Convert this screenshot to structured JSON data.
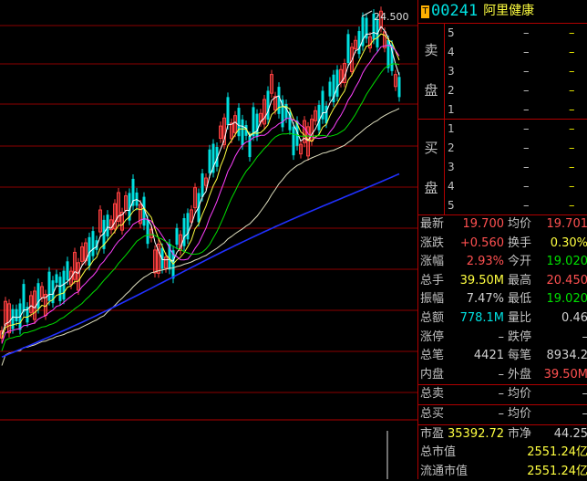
{
  "header": {
    "badge": "T",
    "code": "00241",
    "name": "阿里健康"
  },
  "chart": {
    "peak_label": "24.500",
    "grid_color": "#8b0000"
  },
  "order_book": {
    "sell_label_top": "卖",
    "sell_label_bottom": "盘",
    "buy_label_top": "买",
    "buy_label_bottom": "盘",
    "sell": [
      {
        "level": "5",
        "price": "–",
        "vol": "–"
      },
      {
        "level": "4",
        "price": "–",
        "vol": "–"
      },
      {
        "level": "3",
        "price": "–",
        "vol": "–"
      },
      {
        "level": "2",
        "price": "–",
        "vol": "–"
      },
      {
        "level": "1",
        "price": "–",
        "vol": "–"
      }
    ],
    "buy": [
      {
        "level": "1",
        "price": "–",
        "vol": "–"
      },
      {
        "level": "2",
        "price": "–",
        "vol": "–"
      },
      {
        "level": "3",
        "price": "–",
        "vol": "–"
      },
      {
        "level": "4",
        "price": "–",
        "vol": "–"
      },
      {
        "level": "5",
        "price": "–",
        "vol": "–"
      }
    ]
  },
  "stats": {
    "latest_label": "最新",
    "latest": "19.700",
    "avg_label": "均价",
    "avg": "19.701",
    "change_label": "涨跌",
    "change": "+0.560",
    "turnover_label": "换手",
    "turnover": "0.30%",
    "change_pct_label": "涨幅",
    "change_pct": "2.93%",
    "open_label": "今开",
    "open": "19.020",
    "volume_label": "总手",
    "volume": "39.50M",
    "high_label": "最高",
    "high": "20.450",
    "amplitude_label": "振幅",
    "amplitude": "7.47%",
    "low_label": "最低",
    "low": "19.020",
    "amount_label": "总额",
    "amount": "778.1M",
    "vol_ratio_label": "量比",
    "vol_ratio": "0.46",
    "limit_up_label": "涨停",
    "limit_up": "–",
    "limit_down_label": "跌停",
    "limit_down": "–",
    "trades_label": "总笔",
    "trades": "4421",
    "per_trade_label": "每笔",
    "per_trade": "8934.2",
    "inner_label": "内盘",
    "inner": "–",
    "outer_label": "外盘",
    "outer": "39.50M",
    "total_sell_label": "总卖",
    "total_sell": "–",
    "total_sell_avg_label": "均价",
    "total_sell_avg": "–",
    "total_buy_label": "总买",
    "total_buy": "–",
    "total_buy_avg_label": "均价",
    "total_buy_avg": "–",
    "pe_label": "市盈",
    "pe": "35392.72",
    "pb_label": "市净",
    "pb": "44.25",
    "mcap_label": "总市值",
    "mcap": "2551.24亿",
    "float_mcap_label": "流通市值",
    "float_mcap": "2551.24亿"
  }
}
